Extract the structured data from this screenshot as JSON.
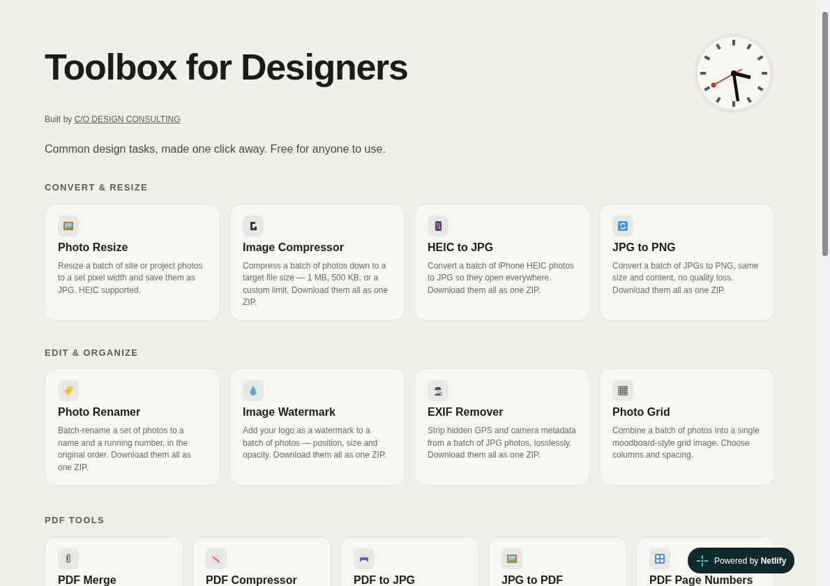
{
  "header": {
    "title": "Toolbox for Designers",
    "byline_prefix": "Built by",
    "byline_link": "C/O DESIGN CONSULTING",
    "tagline": "Common design tasks, made one click away. Free for anyone to use."
  },
  "sections": [
    {
      "title": "CONVERT & RESIZE",
      "cards": [
        {
          "title": "Photo Resize",
          "description": "Resize a batch of site or project photos to a set pixel width and save them as JPG. HEIC supported."
        },
        {
          "title": "Image Compressor",
          "description": "Compress a batch of photos down to a target file size — 1 MB, 500 KB, or a custom limit. Download them all as one ZIP."
        },
        {
          "title": "HEIC to JPG",
          "description": "Convert a batch of iPhone HEIC photos to JPG so they open everywhere. Download them all as one ZIP."
        },
        {
          "title": "JPG to PNG",
          "description": "Convert a batch of JPGs to PNG, same size and content, no quality loss. Download them all as one ZIP."
        }
      ]
    },
    {
      "title": "EDIT & ORGANIZE",
      "cards": [
        {
          "title": "Photo Renamer",
          "description": "Batch-rename a set of photos to a name and a running number, in the original order. Download them all as one ZIP."
        },
        {
          "title": "Image Watermark",
          "description": "Add your logo as a watermark to a batch of photos — position, size and opacity. Download them all as one ZIP."
        },
        {
          "title": "EXIF Remover",
          "description": "Strip hidden GPS and camera metadata from a batch of JPG photos, losslessly. Download them all as one ZIP."
        },
        {
          "title": "Photo Grid",
          "description": "Combine a batch of photos into a single moodboard-style grid image. Choose columns and spacing."
        }
      ]
    },
    {
      "title": "PDF TOOLS",
      "cards": [
        {
          "title": "PDF Merge"
        },
        {
          "title": "PDF Compressor"
        },
        {
          "title": "PDF to JPG"
        },
        {
          "title": "JPG to PDF"
        },
        {
          "title": "PDF Page Numbers"
        }
      ]
    }
  ],
  "badge": {
    "label": "Powered by **Netlify**"
  }
}
